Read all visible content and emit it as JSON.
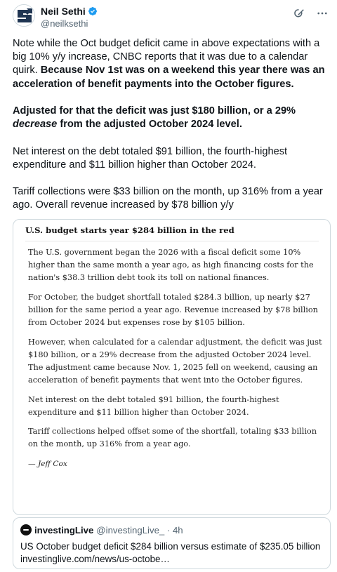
{
  "author": {
    "name": "Neil Sethi",
    "handle": "@neilksethi"
  },
  "tweet": {
    "p1_normal": "Note while the Oct budget deficit came in above expectations with a big 10% y/y increase, CNBC reports that it was due to a calendar quirk.",
    "p1_bold": "Because Nov 1st was on a weekend this year there was an acceleration of benefit payments into the October figures.",
    "p2_bold_a": "Adjusted for that the deficit was just $180 billion, or a 29% ",
    "p2_italic": "decrease",
    "p2_bold_b": " from the adjusted October 2024 level.",
    "p3": "Net interest on the debt totaled $91 billion, the fourth-highest expenditure and $11 billion higher than October 2024.",
    "p4": "Tariff collections were $33 billion on the month, up 316% from a year ago.  Overall revenue increased by $78 billion y/y"
  },
  "article": {
    "title": "U.S. budget starts year $284 billion in the red",
    "paragraphs": [
      "The U.S. government began the 2026 with a fiscal deficit some 10% higher than the same month a year ago, as high financing costs for the nation's $38.3 trillion debt took its toll on national finances.",
      "For October, the budget shortfall totaled $284.3 billion, up nearly $27 billion for the same period a year ago. Revenue increased by $78 billion from October 2024 but expenses rose by $105 billion.",
      "However, when calculated for a calendar adjustment, the deficit was just $180 billion, or a 29% decrease from the adjusted October 2024 level. The adjustment came because Nov. 1, 2025 fell on weekend, causing an acceleration of benefit payments that went into the October figures.",
      "Net interest on the debt totaled $91 billion, the fourth-highest expenditure and $11 billion higher than October 2024.",
      "Tariff collections helped offset some of the shortfall, totaling $33 billion on the month, up 316% from a year ago."
    ],
    "byline": "— Jeff Cox"
  },
  "quote": {
    "name": "investingLive",
    "handle": "@investingLive_ · 4h",
    "line1": "US October budget deficit $284 billion versus estimate of $235.05 billion",
    "line2": "investinglive.com/news/us-octobe…"
  },
  "colors": {
    "text": "#0f1419",
    "secondary": "#536471",
    "verified": "#1d9bf0",
    "border": "#cfd9de"
  },
  "icons": [
    "verified-badge-icon",
    "grok-icon",
    "more-icon"
  ]
}
